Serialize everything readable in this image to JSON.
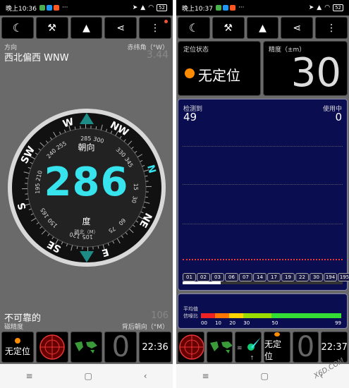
{
  "left": {
    "status": {
      "time": "晚上10:36",
      "dots": "···",
      "battery": "52"
    },
    "direction_label": "方向",
    "direction_value": "西北偏西 WNW",
    "decl_label": "赤纬角（°W）",
    "decl_value": "3.44",
    "heading_label": "朝向",
    "heading_value": "286",
    "degree": "度",
    "north_label": "磁北（M）",
    "accuracy_value": "不可靠的",
    "accuracy_label": "磁精度",
    "back_label": "背后朝向（°M）",
    "back_value": "106",
    "bottom": {
      "fix": "无定位",
      "zero": "0",
      "clock": "22:36"
    },
    "dial_cardinals": [
      "N",
      "NE",
      "E",
      "SE",
      "S",
      "SW",
      "W",
      "NW"
    ],
    "dial_degrees": [
      "15",
      "30",
      "45",
      "60",
      "75",
      "90",
      "105",
      "120",
      "135",
      "150",
      "165",
      "180",
      "195",
      "210",
      "225",
      "240",
      "255",
      "270",
      "285",
      "300",
      "315",
      "330",
      "345",
      "0"
    ]
  },
  "right": {
    "status": {
      "time": "晚上10:37",
      "dots": "···",
      "battery": "52"
    },
    "fix_label": "定位状态",
    "fix_value": "无定位",
    "acc_label": "精度（±m）",
    "acc_value": "30",
    "detected_label": "检测到",
    "detected_value": "49",
    "inuse_label": "使用中",
    "inuse_value": "0",
    "sat_ids": [
      "01",
      "02",
      "03",
      "06",
      "07",
      "14",
      "17",
      "19",
      "22",
      "30",
      "194",
      "195"
    ],
    "snr_title": "平均值",
    "snr_sub": "信噪比",
    "snr_ticks": [
      "00",
      "10",
      "20",
      "30",
      "50",
      "99"
    ],
    "bottom": {
      "fix": "无定位",
      "zero": "0",
      "clock": "22:37"
    }
  },
  "watermark": "X6D.COM",
  "colors": {
    "accent": "#37e3ec",
    "sky": "#0a0d50",
    "orange": "#ff8c00"
  }
}
